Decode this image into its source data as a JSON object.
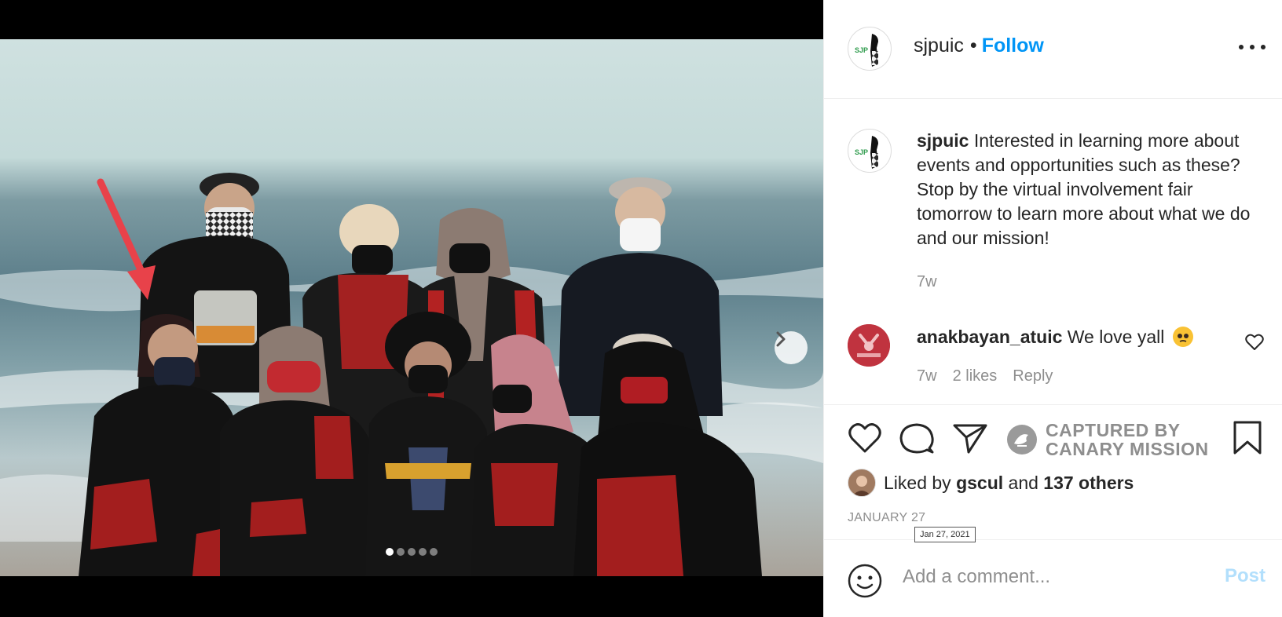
{
  "post": {
    "username": "sjpuic",
    "follow_label": "Follow",
    "separator": "•",
    "more_label": "More options",
    "avatar_text": "SJP"
  },
  "caption": {
    "username": "sjpuic",
    "text": "Interested in learning more about events and opportunities such as these? Stop by the virtual involvement fair tomorrow to learn more about what we do and our mission!",
    "time": "7w"
  },
  "comment": {
    "username": "anakbayan_atuic",
    "text": "We love yall",
    "time": "7w",
    "likes": "2 likes",
    "reply_label": "Reply",
    "avatar_text": "ANAKBAYAN"
  },
  "actions": {
    "canary_line1": "CAPTURED BY",
    "canary_line2": "CANARY MISSION"
  },
  "likes": {
    "prefix": "Liked by",
    "user": "gscul",
    "and": "and",
    "others": "137 others"
  },
  "date": {
    "label": "JANUARY 27",
    "tooltip": "Jan 27, 2021"
  },
  "comment_box": {
    "placeholder": "Add a comment...",
    "post_label": "Post"
  },
  "carousel": {
    "total": 5,
    "active": 1
  },
  "colors": {
    "link_blue": "#0095f6",
    "post_disabled": "#b2dffc",
    "annotation_arrow": "#e8424a"
  }
}
